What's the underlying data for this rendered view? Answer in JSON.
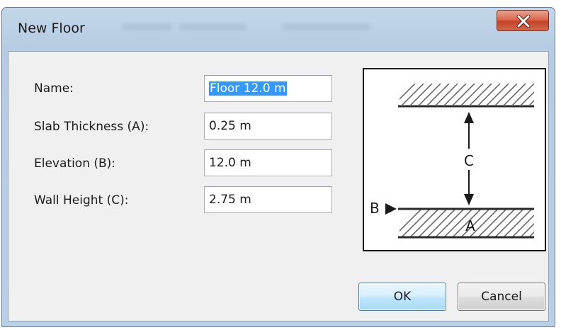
{
  "window": {
    "title": "New Floor",
    "close_glyph": "X"
  },
  "form": {
    "name_label": "Name:",
    "name_value": "Floor 12.0 m",
    "slab_label": "Slab Thickness (A):",
    "slab_value": "0.25 m",
    "elevation_label": "Elevation (B):",
    "elevation_value": "12.0 m",
    "wall_label": "Wall Height (C):",
    "wall_value": "2.75 m"
  },
  "diagram": {
    "label_a": "A",
    "label_b": "B",
    "label_c": "C"
  },
  "buttons": {
    "ok_label": "OK",
    "cancel_label": "Cancel"
  },
  "colors": {
    "selection": "#3399ff",
    "close_button": "#c54228",
    "ok_button_border": "#3c7fb1"
  }
}
